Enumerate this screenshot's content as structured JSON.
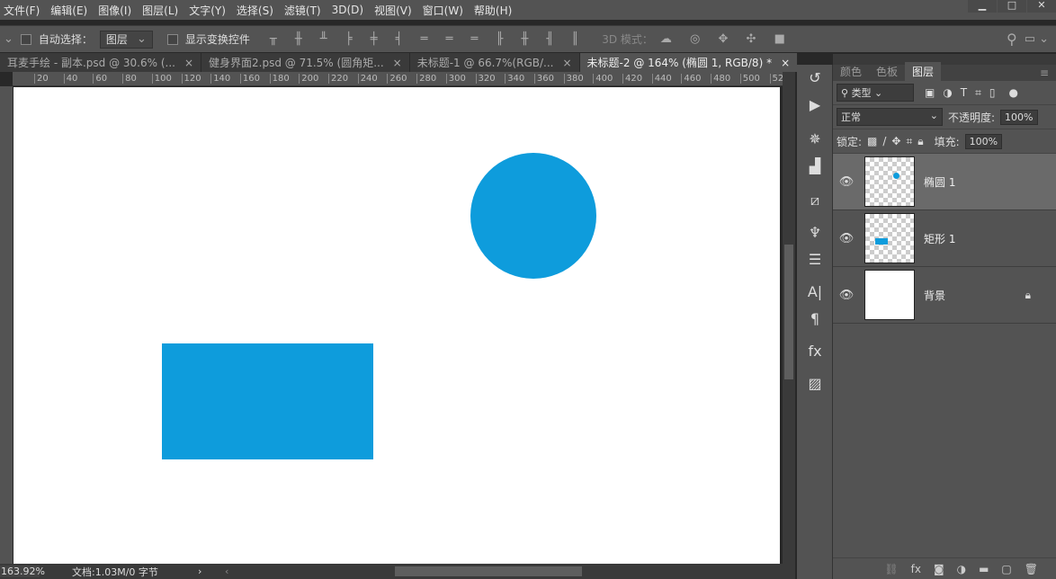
{
  "menu": [
    "文件(F)",
    "编辑(E)",
    "图像(I)",
    "图层(L)",
    "文字(Y)",
    "选择(S)",
    "滤镜(T)",
    "3D(D)",
    "视图(V)",
    "窗口(W)",
    "帮助(H)"
  ],
  "window_buttons": {
    "minimize": "▁",
    "restore": "□",
    "close": "✕"
  },
  "options": {
    "auto_select_label": "自动选择：",
    "auto_select_value": "图层",
    "show_transform_label": "显示变换控件",
    "mode_3d_label": "3D 模式："
  },
  "tabs": [
    {
      "label": "耳麦手绘 - 副本.psd @ 30.6% (...",
      "close": "×"
    },
    {
      "label": "健身界面2.psd @ 71.5% (圆角矩...",
      "close": "×"
    },
    {
      "label": "未标题-1 @ 66.7%(RGB/...",
      "close": "×"
    },
    {
      "label": "未标题-2 @ 164% (椭圆 1, RGB/8) *",
      "close": "×",
      "active": true
    }
  ],
  "ruler_ticks": [
    "20",
    "40",
    "60",
    "80",
    "100",
    "120",
    "140",
    "160",
    "180",
    "200",
    "220",
    "240",
    "260",
    "280",
    "300",
    "320",
    "340",
    "360",
    "380",
    "400",
    "420",
    "440",
    "460",
    "480",
    "500",
    "52"
  ],
  "shapes": {
    "color": "#0e9cdc"
  },
  "status": {
    "zoom": "163.92%",
    "doc": "文档:1.03M/0 字节"
  },
  "panel": {
    "tabs": [
      "颜色",
      "色板",
      "图层"
    ],
    "active_tab": "图层",
    "filter": "类型",
    "blend_mode": "正常",
    "opacity_label": "不透明度:",
    "opacity": "100%",
    "lock_label": "锁定:",
    "fill_label": "填充:",
    "fill": "100%",
    "layers": [
      {
        "name": "椭圆 1",
        "selected": true
      },
      {
        "name": "矩形 1",
        "selected": false
      },
      {
        "name": "背景",
        "locked": true
      }
    ]
  }
}
